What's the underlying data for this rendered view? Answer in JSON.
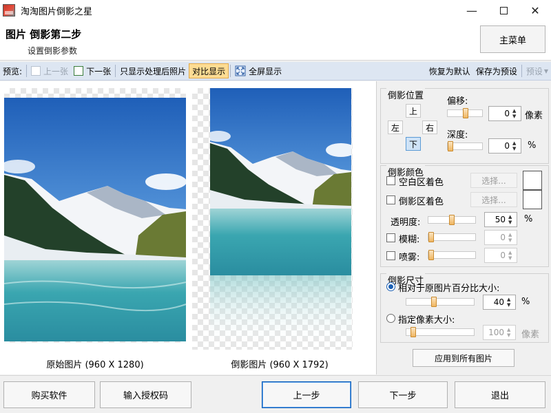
{
  "window": {
    "title": "淘淘图片倒影之星"
  },
  "header": {
    "step_title": "图片 倒影第二步",
    "step_subtitle": "设置倒影参数",
    "main_menu": "主菜单"
  },
  "toolbar": {
    "preview_label": "预览:",
    "prev_image": "上一张",
    "next_image": "下一张",
    "show_processed_only": "只显示处理后照片",
    "compare_view": "对比显示",
    "fullscreen": "全屏显示",
    "restore_default": "恢复为默认",
    "save_preset": "保存为预设",
    "preset": "预设"
  },
  "preview": {
    "original_caption": "原始图片 (960 X 1280)",
    "reflected_caption": "倒影图片 (960 X 1792)"
  },
  "position_group": {
    "title": "倒影位置",
    "up": "上",
    "left": "左",
    "right": "右",
    "down": "下",
    "offset_label": "偏移:",
    "offset_value": "0",
    "offset_unit": "像素",
    "depth_label": "深度:",
    "depth_value": "0",
    "depth_unit": "%"
  },
  "color_group": {
    "title": "倒影颜色",
    "blank_area_color": "空白区着色",
    "reflection_area_color": "倒影区着色",
    "choose": "选择...",
    "transparency_label": "透明度:",
    "transparency_value": "50",
    "transparency_unit": "%",
    "blur_label": "模糊:",
    "blur_value": "0",
    "spray_label": "喷雾:",
    "spray_value": "0"
  },
  "size_group": {
    "title": "倒影尺寸",
    "relative_percent": "相对于原图片百分比大小:",
    "percent_value": "40",
    "percent_unit": "%",
    "pixel_size": "指定像素大小:",
    "pixel_value": "100",
    "pixel_unit": "像素"
  },
  "apply_all": "应用到所有图片",
  "bottom": {
    "buy": "购买软件",
    "license": "输入授权码",
    "prev_step": "上一步",
    "next_step": "下一步",
    "exit": "退出"
  }
}
